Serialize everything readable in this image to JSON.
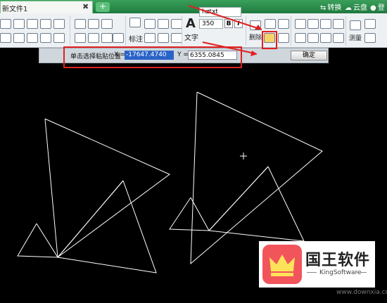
{
  "titlebar": {
    "tab_label": "新文件1",
    "tab_close": "✖",
    "new_tab": "+",
    "convert_label": "转换",
    "cloud_label": "云盘",
    "login_label": "登录"
  },
  "ribbon": {
    "annotate_label": "标注",
    "text_label": "文字",
    "font_value": "hztxt",
    "size_value": "350",
    "bold": "B",
    "italic": "I",
    "delete_label": "删除",
    "measure_label": "测量"
  },
  "pastebar": {
    "instruction": "单击选择粘贴位置",
    "x_label": "X =",
    "x_value": "-17647.4740",
    "y_label": "Y =",
    "y_value": "6355.0845",
    "ok_label": "确定"
  },
  "watermark": {
    "name_cn": "国王软件",
    "name_en": "KingSoftware",
    "site": "www.downxia.com"
  },
  "colors": {
    "title_green": "#1f7a3f",
    "canvas_bg": "#000000",
    "highlight_red": "#e02020",
    "selection_blue": "#2a63c8"
  }
}
